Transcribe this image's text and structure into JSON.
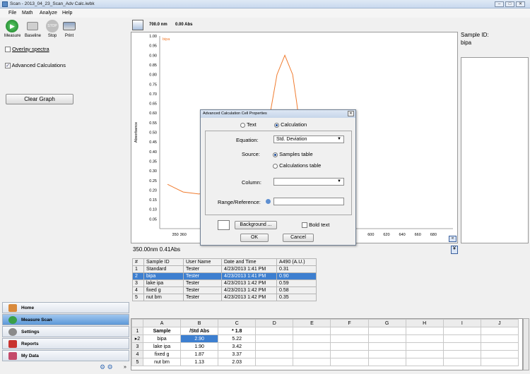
{
  "window": {
    "title": "Scan - 2013_04_23_Scan_Adv Calc.iwbk"
  },
  "menu": [
    "File",
    "Math",
    "Analyze",
    "Help"
  ],
  "toolbar": {
    "measure": "Measure",
    "baseline": "Baseline",
    "stop": "Stop",
    "stop_icon_text": "STOP",
    "print": "Print"
  },
  "options": {
    "overlay": "Overlay spectra",
    "advanced": "Advanced Calculations",
    "clear": "Clear Graph"
  },
  "graph_toolbar": {
    "wavelength": "700.0 nm",
    "abs": "0.00 Abs"
  },
  "readout": "350.00nm 0.41Abs",
  "sample_info": {
    "label": "Sample ID:",
    "value": "bipa"
  },
  "nav": [
    "Home",
    "Measure Scan",
    "Settings",
    "Reports",
    "My Data"
  ],
  "samples": {
    "headers": [
      "#",
      "Sample ID",
      "User Name",
      "Date and Time",
      "A490 (A.U.)"
    ],
    "rows": [
      [
        "1",
        "Standard",
        "Tester",
        "4/23/2013 1:41 PM",
        "0.31"
      ],
      [
        "2",
        "bipa",
        "Tester",
        "4/23/2013 1:41 PM",
        "0.90"
      ],
      [
        "3",
        "lake ipa",
        "Tester",
        "4/23/2013 1:42 PM",
        "0.59"
      ],
      [
        "4",
        "fixed g",
        "Tester",
        "4/23/2013 1:42 PM",
        "0.58"
      ],
      [
        "5",
        "nut brn",
        "Tester",
        "4/23/2013 1:42 PM",
        "0.35"
      ]
    ]
  },
  "sheet": {
    "cols": [
      "A",
      "B",
      "C",
      "D",
      "E",
      "F",
      "G",
      "H",
      "I",
      "J"
    ],
    "rows": [
      [
        "1",
        "Sample",
        "/Std Abs",
        "* 1.8"
      ],
      [
        "▸2",
        "bipa",
        "2.90",
        "5.22"
      ],
      [
        "3",
        "lake ipa",
        "1.90",
        "3.42"
      ],
      [
        "4",
        "fixed g",
        "1.87",
        "3.37"
      ],
      [
        "5",
        "nut brn",
        "1.13",
        "2.03"
      ]
    ]
  },
  "dialog": {
    "title": "Advanced Calculation Cell Properties",
    "text": "Text",
    "calculation": "Calculation",
    "equation_label": "Equation:",
    "equation_value": "Std. Deviation",
    "source_label": "Source:",
    "source_samples": "Samples table",
    "source_calc": "Calculations table",
    "column_label": "Column:",
    "column_value": "",
    "range_label": "Range/Reference:",
    "background": "Background ...",
    "bold": "Bold text",
    "ok": "OK",
    "cancel": "Cancel"
  },
  "chart_data": {
    "type": "line",
    "series": [
      {
        "name": "bipa",
        "color": "#f07b2e",
        "x": [
          340,
          350,
          360,
          380,
          400,
          420,
          440,
          450,
          460,
          470,
          480,
          490,
          500,
          505,
          510,
          520,
          530,
          540,
          550,
          560,
          570
        ],
        "y": [
          0.23,
          0.21,
          0.19,
          0.18,
          0.19,
          0.21,
          0.25,
          0.3,
          0.4,
          0.57,
          0.8,
          0.9,
          0.8,
          0.66,
          0.5,
          0.3,
          0.18,
          0.11,
          0.07,
          0.05,
          0.04
        ]
      }
    ],
    "ylabel": "Absorbance",
    "ylim": [
      0,
      1.0
    ],
    "xlim": [
      330,
      705
    ],
    "yticks": [
      "1.00",
      "0.95",
      "0.90",
      "0.85",
      "0.80",
      "0.75",
      "0.70",
      "0.65",
      "0.60",
      "0.55",
      "0.50",
      "0.45",
      "0.40",
      "0.35",
      "0.30",
      "0.25",
      "0.20",
      "0.15",
      "0.10",
      "0.05"
    ],
    "xticks": [
      "350",
      "360",
      "600",
      "620",
      "640",
      "660",
      "680"
    ],
    "grid": false
  }
}
